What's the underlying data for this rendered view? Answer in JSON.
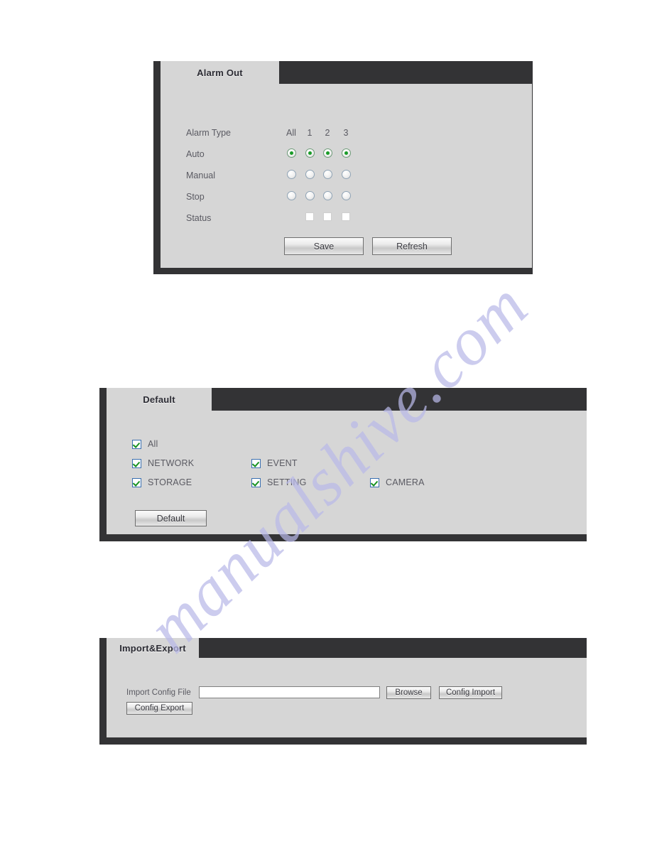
{
  "watermark": {
    "text": "manualshive.com"
  },
  "alarm_out": {
    "tab_label": "Alarm Out",
    "rows": {
      "alarm_type_label": "Alarm Type",
      "auto_label": "Auto",
      "manual_label": "Manual",
      "stop_label": "Stop",
      "status_label": "Status"
    },
    "columns": [
      "All",
      "1",
      "2",
      "3"
    ],
    "selection": {
      "auto": [
        true,
        true,
        true,
        true
      ],
      "manual": [
        false,
        false,
        false,
        false
      ],
      "stop": [
        false,
        false,
        false,
        false
      ]
    },
    "status_indicators": [
      "off",
      "off",
      "off"
    ],
    "buttons": {
      "save": "Save",
      "refresh": "Refresh"
    }
  },
  "default_panel": {
    "tab_label": "Default",
    "checkboxes": [
      {
        "label": "All",
        "checked": true
      },
      {
        "label": "NETWORK",
        "checked": true
      },
      {
        "label": "EVENT",
        "checked": true
      },
      {
        "label": "STORAGE",
        "checked": true
      },
      {
        "label": "SETTING",
        "checked": true
      },
      {
        "label": "CAMERA",
        "checked": true
      }
    ],
    "buttons": {
      "default": "Default"
    }
  },
  "import_export": {
    "tab_label": "Import&Export",
    "import_config_file_label": "Import Config File",
    "file_path_value": "",
    "file_path_placeholder": "",
    "buttons": {
      "browse": "Browse",
      "config_import": "Config Import",
      "config_export": "Config Export"
    }
  },
  "colors": {
    "frame": "#333335",
    "panel_bg": "#d6d6d6",
    "radio_on": "#1a9c28",
    "check_green": "#179121",
    "check_border": "#3a6fb0",
    "watermark": "#b9b9e8"
  }
}
